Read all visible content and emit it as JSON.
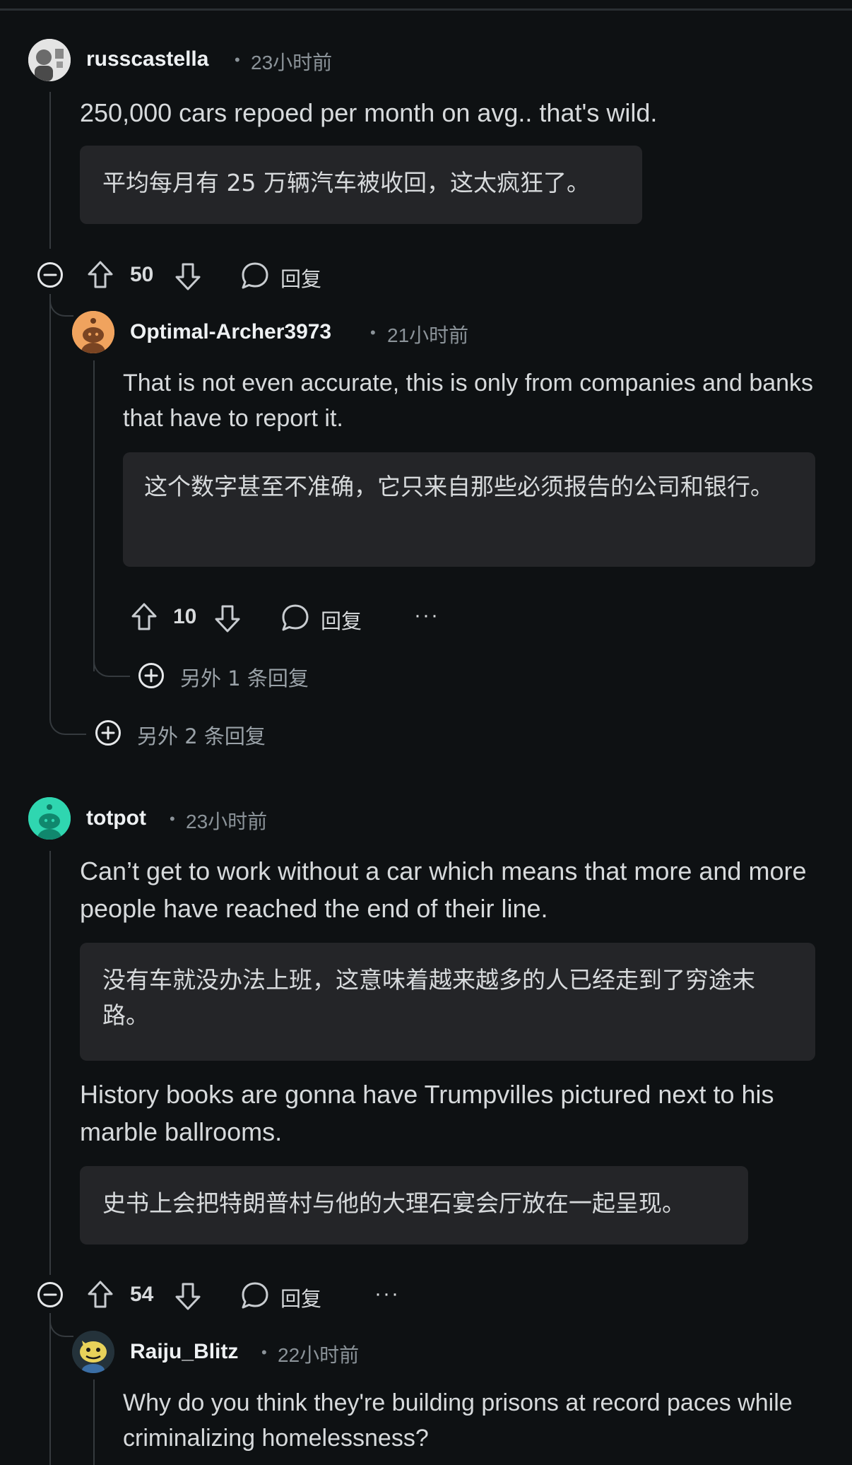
{
  "comments": [
    {
      "username": "russcastella",
      "time": "23小时前",
      "text": "250,000 cars repoed per month on avg.. that's wild.",
      "translation": "平均每月有 25 万辆汽车被收回，这太疯狂了。",
      "votes": "50",
      "reply_label": "回复",
      "more_replies": "另外 2 条回复"
    },
    {
      "username": "Optimal-Archer3973",
      "time": "21小时前",
      "text": "That is not even accurate, this is only from companies and banks that have to report it.",
      "translation": "这个数字甚至不准确，它只来自那些必须报告的公司和银行。",
      "votes": "10",
      "reply_label": "回复",
      "more_label": "···",
      "more_replies": "另外 1 条回复"
    },
    {
      "username": "totpot",
      "time": "23小时前",
      "text": "Can’t get to work without a car which means that more and more people have reached the end of their line.",
      "translation": "没有车就没办法上班，这意味着越来越多的人已经走到了穷途末路。",
      "text2": "History books are gonna have Trumpvilles pictured next to his marble ballrooms.",
      "translation2": "史书上会把特朗普村与他的大理石宴会厅放在一起呈现。",
      "votes": "54",
      "reply_label": "回复",
      "more_label": "···"
    },
    {
      "username": "Raiju_Blitz",
      "time": "22小时前",
      "text": "Why do you think they're building prisons at record paces while criminalizing homelessness?"
    }
  ],
  "separator": "•"
}
